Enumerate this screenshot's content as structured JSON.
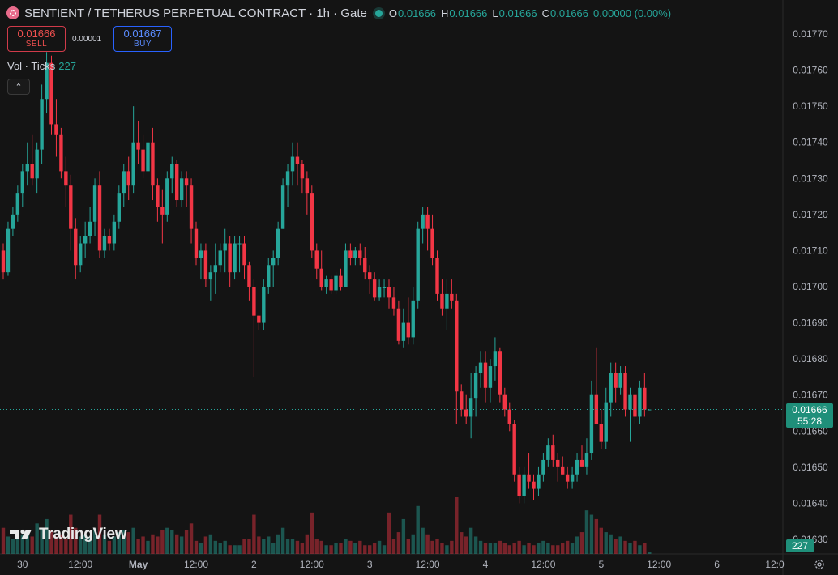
{
  "header": {
    "title": "SENTIENT / TETHERUS PERPETUAL CONTRACT · 1h · Gate",
    "ohlc": [
      {
        "k": "O",
        "v": "0.01666"
      },
      {
        "k": "H",
        "v": "0.01666"
      },
      {
        "k": "L",
        "v": "0.01666"
      },
      {
        "k": "C",
        "v": "0.01666"
      }
    ],
    "change": "0.00000 (0.00%)"
  },
  "trade": {
    "sell_price": "0.01666",
    "sell_label": "SELL",
    "spread": "0.00001",
    "buy_price": "0.01667",
    "buy_label": "BUY"
  },
  "volume": {
    "label": "Vol · Ticks",
    "value": "227"
  },
  "branding": "TradingView",
  "last_price": {
    "price": "0.01666",
    "countdown": "55:28"
  },
  "volume_last": "227",
  "colors": {
    "up": "#26a69a",
    "down": "#f23645",
    "background": "#141414"
  },
  "chart_data": {
    "type": "candlestick",
    "y_axis": {
      "min": 0.0163,
      "max": 0.0177,
      "ticks": [
        "0.01770",
        "0.01760",
        "0.01750",
        "0.01740",
        "0.01730",
        "0.01720",
        "0.01710",
        "0.01700",
        "0.01690",
        "0.01680",
        "0.01670",
        "0.01660",
        "0.01650",
        "0.01640",
        "0.01630"
      ]
    },
    "x_axis": {
      "ticks": [
        {
          "label": "30",
          "bar": 4
        },
        {
          "label": "12:00",
          "bar": 16
        },
        {
          "label": "May",
          "bar": 28,
          "bold": true
        },
        {
          "label": "12:00",
          "bar": 40
        },
        {
          "label": "2",
          "bar": 52
        },
        {
          "label": "12:00",
          "bar": 64
        },
        {
          "label": "3",
          "bar": 76
        },
        {
          "label": "12:00",
          "bar": 88
        },
        {
          "label": "4",
          "bar": 100
        },
        {
          "label": "12:00",
          "bar": 112
        },
        {
          "label": "5",
          "bar": 124
        },
        {
          "label": "12:00",
          "bar": 136
        },
        {
          "label": "6",
          "bar": 148
        },
        {
          "label": "12:0",
          "bar": 160
        }
      ]
    },
    "candles": [
      [
        0.0171,
        0.01712,
        0.01702,
        0.01704,
        60
      ],
      [
        0.01704,
        0.01718,
        0.01703,
        0.01716,
        40
      ],
      [
        0.01716,
        0.01722,
        0.01714,
        0.0172,
        35
      ],
      [
        0.0172,
        0.01728,
        0.01718,
        0.01726,
        50
      ],
      [
        0.01726,
        0.01734,
        0.01722,
        0.01732,
        45
      ],
      [
        0.01732,
        0.0174,
        0.01728,
        0.01734,
        55
      ],
      [
        0.01734,
        0.01742,
        0.01728,
        0.0173,
        40
      ],
      [
        0.0173,
        0.0174,
        0.01726,
        0.01738,
        70
      ],
      [
        0.01738,
        0.01756,
        0.01734,
        0.01752,
        60
      ],
      [
        0.01752,
        0.01765,
        0.01748,
        0.01762,
        80
      ],
      [
        0.01762,
        0.01764,
        0.01742,
        0.01745,
        55
      ],
      [
        0.01745,
        0.01752,
        0.01736,
        0.01742,
        40
      ],
      [
        0.01742,
        0.01744,
        0.0173,
        0.01732,
        45
      ],
      [
        0.01732,
        0.01736,
        0.01722,
        0.01728,
        35
      ],
      [
        0.01728,
        0.01731,
        0.0171,
        0.01716,
        90
      ],
      [
        0.01716,
        0.01719,
        0.01702,
        0.01706,
        60
      ],
      [
        0.01706,
        0.01714,
        0.01704,
        0.01712,
        40
      ],
      [
        0.01712,
        0.01718,
        0.01708,
        0.01714,
        45
      ],
      [
        0.01714,
        0.01722,
        0.01712,
        0.01718,
        40
      ],
      [
        0.01718,
        0.0173,
        0.01714,
        0.01728,
        60
      ],
      [
        0.01728,
        0.01732,
        0.01708,
        0.0171,
        90
      ],
      [
        0.0171,
        0.01716,
        0.01708,
        0.01714,
        45
      ],
      [
        0.01714,
        0.01716,
        0.0171,
        0.01712,
        30
      ],
      [
        0.01712,
        0.0172,
        0.0171,
        0.01718,
        40
      ],
      [
        0.01718,
        0.01728,
        0.01716,
        0.01726,
        50
      ],
      [
        0.01726,
        0.01734,
        0.01722,
        0.01732,
        55
      ],
      [
        0.01732,
        0.01736,
        0.01724,
        0.01728,
        50
      ],
      [
        0.01728,
        0.0175,
        0.01726,
        0.0174,
        60
      ],
      [
        0.0174,
        0.01746,
        0.01734,
        0.01738,
        35
      ],
      [
        0.01738,
        0.01742,
        0.0173,
        0.01732,
        40
      ],
      [
        0.01732,
        0.01742,
        0.01728,
        0.0174,
        30
      ],
      [
        0.0174,
        0.01744,
        0.01724,
        0.01728,
        45
      ],
      [
        0.01728,
        0.0173,
        0.01718,
        0.01722,
        40
      ],
      [
        0.01722,
        0.01727,
        0.01712,
        0.0172,
        55
      ],
      [
        0.0172,
        0.01732,
        0.01718,
        0.0173,
        60
      ],
      [
        0.0173,
        0.01736,
        0.01726,
        0.01734,
        55
      ],
      [
        0.01734,
        0.01735,
        0.01722,
        0.01724,
        45
      ],
      [
        0.01724,
        0.01732,
        0.01722,
        0.0173,
        40
      ],
      [
        0.0173,
        0.01732,
        0.01722,
        0.01728,
        55
      ],
      [
        0.01728,
        0.0173,
        0.01712,
        0.01716,
        70
      ],
      [
        0.01716,
        0.01718,
        0.01706,
        0.01708,
        30
      ],
      [
        0.01708,
        0.01712,
        0.01702,
        0.0171,
        25
      ],
      [
        0.0171,
        0.01712,
        0.017,
        0.01702,
        40
      ],
      [
        0.01702,
        0.01706,
        0.01696,
        0.01704,
        45
      ],
      [
        0.01704,
        0.01712,
        0.01698,
        0.01706,
        30
      ],
      [
        0.01706,
        0.01712,
        0.01704,
        0.0171,
        25
      ],
      [
        0.0171,
        0.01716,
        0.01704,
        0.01712,
        30
      ],
      [
        0.01712,
        0.01714,
        0.017,
        0.01704,
        20
      ],
      [
        0.01704,
        0.01714,
        0.01702,
        0.01712,
        20
      ],
      [
        0.01712,
        0.01714,
        0.01704,
        0.01712,
        20
      ],
      [
        0.01712,
        0.01714,
        0.01702,
        0.01706,
        35
      ],
      [
        0.01706,
        0.01707,
        0.01696,
        0.017,
        35
      ],
      [
        0.017,
        0.01702,
        0.01675,
        0.01692,
        90
      ],
      [
        0.01692,
        0.01692,
        0.01688,
        0.0169,
        40
      ],
      [
        0.0169,
        0.01702,
        0.01688,
        0.017,
        35
      ],
      [
        0.017,
        0.01708,
        0.01698,
        0.01706,
        40
      ],
      [
        0.01706,
        0.0171,
        0.017,
        0.01708,
        25
      ],
      [
        0.01708,
        0.01718,
        0.01706,
        0.01716,
        45
      ],
      [
        0.01716,
        0.0173,
        0.01716,
        0.01728,
        60
      ],
      [
        0.01728,
        0.01734,
        0.01722,
        0.01732,
        35
      ],
      [
        0.01732,
        0.0174,
        0.01728,
        0.01736,
        35
      ],
      [
        0.01736,
        0.0174,
        0.01728,
        0.01734,
        30
      ],
      [
        0.01734,
        0.01735,
        0.01726,
        0.0173,
        25
      ],
      [
        0.0173,
        0.01732,
        0.0172,
        0.01726,
        45
      ],
      [
        0.01726,
        0.01728,
        0.01708,
        0.0171,
        95
      ],
      [
        0.0171,
        0.01712,
        0.01702,
        0.01705,
        35
      ],
      [
        0.01705,
        0.0171,
        0.01699,
        0.017,
        30
      ],
      [
        0.017,
        0.01703,
        0.01698,
        0.01702,
        20
      ],
      [
        0.01702,
        0.01703,
        0.01698,
        0.01699,
        20
      ],
      [
        0.01699,
        0.01704,
        0.01698,
        0.01703,
        25
      ],
      [
        0.01703,
        0.01705,
        0.01699,
        0.017,
        25
      ],
      [
        0.017,
        0.01712,
        0.017,
        0.0171,
        35
      ],
      [
        0.0171,
        0.01712,
        0.01706,
        0.01708,
        30
      ],
      [
        0.01708,
        0.01711,
        0.01706,
        0.0171,
        25
      ],
      [
        0.0171,
        0.01712,
        0.01706,
        0.01708,
        30
      ],
      [
        0.01708,
        0.01711,
        0.01702,
        0.01704,
        20
      ],
      [
        0.01704,
        0.01706,
        0.01698,
        0.01702,
        20
      ],
      [
        0.01702,
        0.01704,
        0.01696,
        0.01697,
        25
      ],
      [
        0.01697,
        0.01702,
        0.01696,
        0.017,
        30
      ],
      [
        0.017,
        0.01702,
        0.01697,
        0.017,
        20
      ],
      [
        0.017,
        0.01702,
        0.01694,
        0.01697,
        95
      ],
      [
        0.01697,
        0.017,
        0.01692,
        0.01694,
        35
      ],
      [
        0.01694,
        0.01696,
        0.01684,
        0.01685,
        50
      ],
      [
        0.01685,
        0.01694,
        0.01683,
        0.0169,
        80
      ],
      [
        0.0169,
        0.01697,
        0.01684,
        0.01686,
        35
      ],
      [
        0.01686,
        0.017,
        0.01684,
        0.01696,
        45
      ],
      [
        0.01696,
        0.01718,
        0.01694,
        0.01716,
        110
      ],
      [
        0.01716,
        0.01722,
        0.01712,
        0.0172,
        60
      ],
      [
        0.0172,
        0.01722,
        0.0171,
        0.01716,
        45
      ],
      [
        0.01716,
        0.0172,
        0.01706,
        0.01708,
        30
      ],
      [
        0.01708,
        0.0171,
        0.01696,
        0.01698,
        35
      ],
      [
        0.01698,
        0.01702,
        0.01692,
        0.01694,
        25
      ],
      [
        0.01694,
        0.01702,
        0.01688,
        0.01698,
        20
      ],
      [
        0.01698,
        0.01702,
        0.01694,
        0.01696,
        30
      ],
      [
        0.01696,
        0.01698,
        0.01662,
        0.01671,
        130
      ],
      [
        0.01671,
        0.01673,
        0.01664,
        0.01666,
        50
      ],
      [
        0.01666,
        0.0167,
        0.01662,
        0.01664,
        40
      ],
      [
        0.01664,
        0.01676,
        0.01658,
        0.01669,
        60
      ],
      [
        0.01669,
        0.01678,
        0.01664,
        0.01676,
        40
      ],
      [
        0.01676,
        0.01682,
        0.01672,
        0.01679,
        30
      ],
      [
        0.01679,
        0.01682,
        0.01668,
        0.01672,
        25
      ],
      [
        0.01672,
        0.0168,
        0.01668,
        0.01678,
        25
      ],
      [
        0.01678,
        0.01686,
        0.01674,
        0.01682,
        25
      ],
      [
        0.01682,
        0.01683,
        0.01668,
        0.0167,
        30
      ],
      [
        0.0167,
        0.01672,
        0.01664,
        0.01666,
        25
      ],
      [
        0.01666,
        0.01668,
        0.0166,
        0.01662,
        20
      ],
      [
        0.01662,
        0.01663,
        0.01646,
        0.01648,
        25
      ],
      [
        0.01648,
        0.0165,
        0.0164,
        0.01642,
        30
      ],
      [
        0.01642,
        0.0165,
        0.0164,
        0.01648,
        20
      ],
      [
        0.01648,
        0.01654,
        0.01644,
        0.01646,
        25
      ],
      [
        0.01646,
        0.01648,
        0.01641,
        0.01644,
        20
      ],
      [
        0.01644,
        0.0165,
        0.01642,
        0.01648,
        25
      ],
      [
        0.01648,
        0.01654,
        0.01646,
        0.01652,
        30
      ],
      [
        0.01652,
        0.01658,
        0.0165,
        0.01656,
        25
      ],
      [
        0.01656,
        0.01659,
        0.0165,
        0.01652,
        20
      ],
      [
        0.01652,
        0.01654,
        0.01646,
        0.0165,
        20
      ],
      [
        0.0165,
        0.01653,
        0.01648,
        0.01648,
        25
      ],
      [
        0.01648,
        0.0165,
        0.01644,
        0.01646,
        30
      ],
      [
        0.01646,
        0.0165,
        0.01644,
        0.01648,
        25
      ],
      [
        0.01648,
        0.01654,
        0.01646,
        0.01652,
        40
      ],
      [
        0.01652,
        0.01656,
        0.0165,
        0.0165,
        50
      ],
      [
        0.0165,
        0.01658,
        0.01648,
        0.01654,
        100
      ],
      [
        0.01654,
        0.01674,
        0.01652,
        0.0167,
        90
      ],
      [
        0.0167,
        0.01683,
        0.01664,
        0.01662,
        80
      ],
      [
        0.01662,
        0.01666,
        0.01655,
        0.01657,
        60
      ],
      [
        0.01657,
        0.01672,
        0.01655,
        0.01668,
        50
      ],
      [
        0.01668,
        0.01679,
        0.01664,
        0.01676,
        45
      ],
      [
        0.01676,
        0.01679,
        0.01668,
        0.01672,
        35
      ],
      [
        0.01672,
        0.01678,
        0.0167,
        0.01676,
        40
      ],
      [
        0.01676,
        0.01678,
        0.01664,
        0.01666,
        30
      ],
      [
        0.01666,
        0.01672,
        0.01657,
        0.0167,
        25
      ],
      [
        0.0167,
        0.0167,
        0.01662,
        0.01664,
        30
      ],
      [
        0.01664,
        0.01674,
        0.01662,
        0.01672,
        20
      ],
      [
        0.01672,
        0.01676,
        0.01664,
        0.01666,
        25
      ],
      [
        0.01666,
        0.01666,
        0.01666,
        0.01666,
        5
      ]
    ]
  }
}
